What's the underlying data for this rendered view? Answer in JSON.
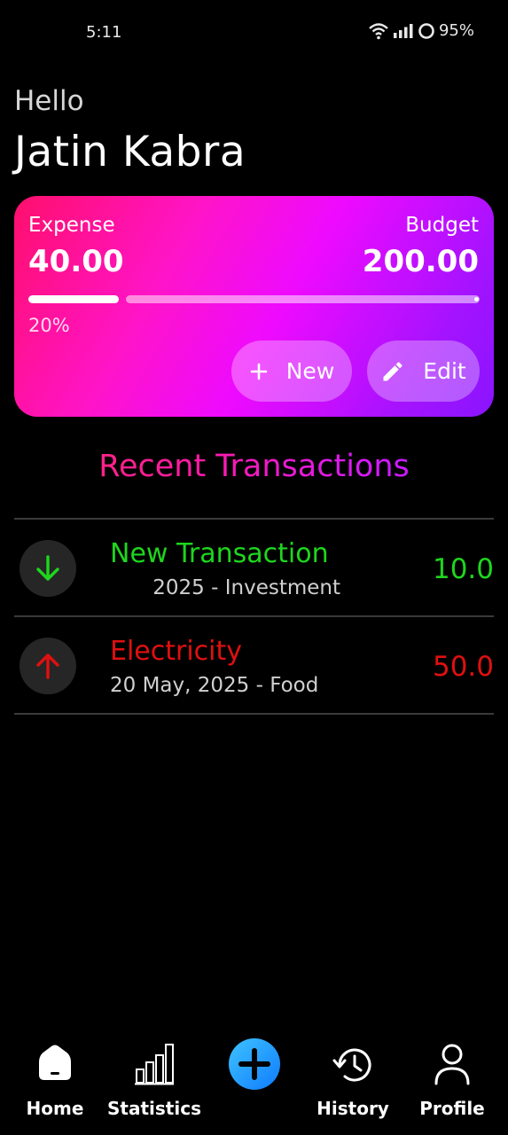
{
  "status_bar": {
    "time": "5:11",
    "battery": "95%"
  },
  "header": {
    "greeting": "Hello",
    "user_name": "Jatin Kabra"
  },
  "budget_card": {
    "expense_label": "Expense",
    "expense_value": "40.00",
    "budget_label": "Budget",
    "budget_value": "200.00",
    "progress_percent": "20%",
    "progress_fraction": 0.2,
    "new_button": "New",
    "edit_button": "Edit",
    "colors": {
      "start": "#ff0f6c",
      "mid": "#ee0aff",
      "end": "#8a14ff"
    }
  },
  "recent": {
    "title": "Recent Transactions",
    "transactions": [
      {
        "title": "New Transaction",
        "subtitle": "2025 - Investment",
        "amount": "10.0",
        "direction": "in",
        "icon": "arrow-down-icon",
        "color": "#1ed61e"
      },
      {
        "title": "Electricity",
        "subtitle": "20 May, 2025 - Food",
        "amount": "50.0",
        "direction": "out",
        "icon": "arrow-up-icon",
        "color": "#e01010"
      }
    ]
  },
  "bottom_nav": {
    "items": [
      {
        "label": "Home",
        "icon": "home-icon"
      },
      {
        "label": "Statistics",
        "icon": "bar-chart-icon"
      },
      {
        "label": "",
        "icon": "add-icon"
      },
      {
        "label": "History",
        "icon": "history-icon"
      },
      {
        "label": "Profile",
        "icon": "profile-icon"
      }
    ]
  }
}
